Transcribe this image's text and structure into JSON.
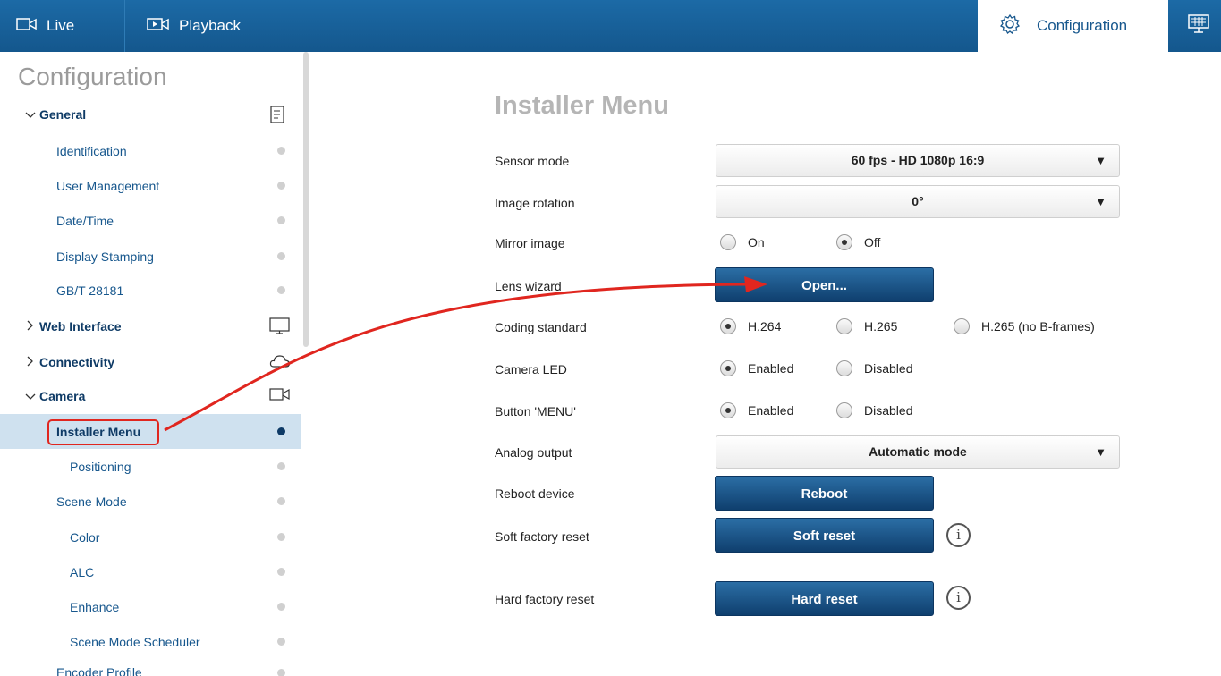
{
  "topbar": {
    "live_label": "Live",
    "playback_label": "Playback",
    "config_label": "Configuration"
  },
  "sidebar": {
    "title": "Configuration",
    "items": [
      {
        "label": "General",
        "type": "group",
        "expanded": true,
        "icon": "document-list-icon"
      },
      {
        "label": "Identification",
        "type": "item"
      },
      {
        "label": "User Management",
        "type": "item"
      },
      {
        "label": "Date/Time",
        "type": "item"
      },
      {
        "label": "Display Stamping",
        "type": "item"
      },
      {
        "label": "GB/T 28181",
        "type": "item"
      },
      {
        "label": "Web Interface",
        "type": "group",
        "expanded": false,
        "icon": "monitor-icon"
      },
      {
        "label": "Connectivity",
        "type": "group",
        "expanded": false,
        "icon": "cloud-icon"
      },
      {
        "label": "Camera",
        "type": "group",
        "expanded": true,
        "icon": "video-camera-icon"
      },
      {
        "label": "Installer Menu",
        "type": "item",
        "active": true
      },
      {
        "label": "Positioning",
        "type": "subitem"
      },
      {
        "label": "Scene Mode",
        "type": "item"
      },
      {
        "label": "Color",
        "type": "subitem"
      },
      {
        "label": "ALC",
        "type": "subitem"
      },
      {
        "label": "Enhance",
        "type": "subitem"
      },
      {
        "label": "Scene Mode Scheduler",
        "type": "subitem"
      },
      {
        "label": "Encoder Profile",
        "type": "item"
      }
    ]
  },
  "main": {
    "title": "Installer Menu",
    "sensor_mode": {
      "label": "Sensor mode",
      "value": "60 fps - HD 1080p 16:9"
    },
    "image_rotation": {
      "label": "Image rotation",
      "value": "0°"
    },
    "mirror_image": {
      "label": "Mirror image",
      "options": [
        "On",
        "Off"
      ],
      "selected": "Off"
    },
    "lens_wizard": {
      "label": "Lens wizard",
      "button": "Open..."
    },
    "coding_standard": {
      "label": "Coding standard",
      "options": [
        "H.264",
        "H.265",
        "H.265 (no B-frames)"
      ],
      "selected": "H.264"
    },
    "camera_led": {
      "label": "Camera LED",
      "options": [
        "Enabled",
        "Disabled"
      ],
      "selected": "Enabled"
    },
    "button_menu": {
      "label": "Button 'MENU'",
      "options": [
        "Enabled",
        "Disabled"
      ],
      "selected": "Enabled"
    },
    "analog_output": {
      "label": "Analog output",
      "value": "Automatic mode"
    },
    "reboot": {
      "label": "Reboot device",
      "button": "Reboot"
    },
    "soft_reset": {
      "label": "Soft factory reset",
      "button": "Soft reset"
    },
    "hard_reset": {
      "label": "Hard factory reset",
      "button": "Hard reset"
    }
  },
  "colors": {
    "brand_blue": "#17578d",
    "annotation_red": "#e0261f"
  }
}
